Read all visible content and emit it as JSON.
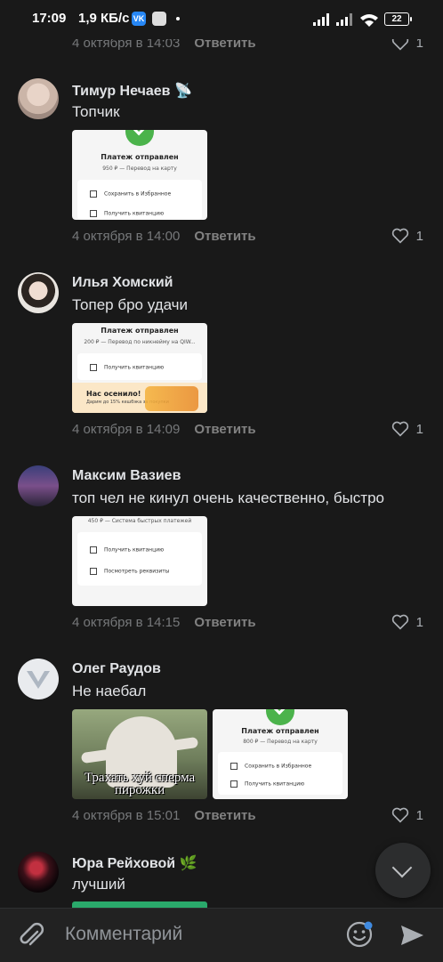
{
  "status_bar": {
    "time": "17:09",
    "speed": "1,9 КБ/с",
    "vk_badge": "VK",
    "battery": "22"
  },
  "comments": [
    {
      "meta_time": "4 октября в 14:03",
      "reply": "Ответить",
      "likes": "1"
    },
    {
      "author": "Тимур Нечаев",
      "author_emoji": "📡",
      "text": "Топчик",
      "attachment": {
        "title": "Платеж отправлен",
        "subtitle": "950 ₽ — Перевод на карту",
        "rows": [
          "Сохранить в Избранное",
          "Получить квитанцию"
        ]
      },
      "meta_time": "4 октября в 14:00",
      "reply": "Ответить",
      "likes": "1"
    },
    {
      "author": "Илья Хомский",
      "text": "Топер бро удачи",
      "attachment": {
        "title": "Платеж отправлен",
        "subtitle": "200 ₽ — Перевод по никнейму на QIW...",
        "rows": [
          "Получить квитанцию"
        ],
        "promo_title": "Нас осенило!",
        "promo_text": "Дарим до 15% кешбэка за покупки"
      },
      "meta_time": "4 октября в 14:09",
      "reply": "Ответить",
      "likes": "1"
    },
    {
      "author": "Максим Вазиев",
      "text": "топ чел не кинул очень качественно, быстро",
      "attachment": {
        "subtitle": "450 ₽ — Система быстрых платежей",
        "rows": [
          "Получить квитанцию",
          "Посмотреть реквизиты"
        ]
      },
      "meta_time": "4 октября в 14:15",
      "reply": "Ответить",
      "likes": "1"
    },
    {
      "author": "Олег Раудов",
      "text": "Не наебал",
      "meme_caption": "Трахать хуй сперма пирожки",
      "attachment": {
        "title": "Платеж отправлен",
        "subtitle": "800 ₽ — Перевод на карту",
        "rows": [
          "Сохранить в Избранное",
          "Получить квитанцию"
        ]
      },
      "meta_time": "4 октября в 15:01",
      "reply": "Ответить",
      "likes": "1"
    },
    {
      "author": "Юра Рейховой",
      "author_emoji": "🌿",
      "text": "лучший"
    }
  ],
  "composer": {
    "placeholder": "Комментарий"
  },
  "colors": {
    "background": "#191919",
    "text": "#e1e3e6",
    "secondary": "#76787a",
    "accent_green": "#4bb34b"
  }
}
